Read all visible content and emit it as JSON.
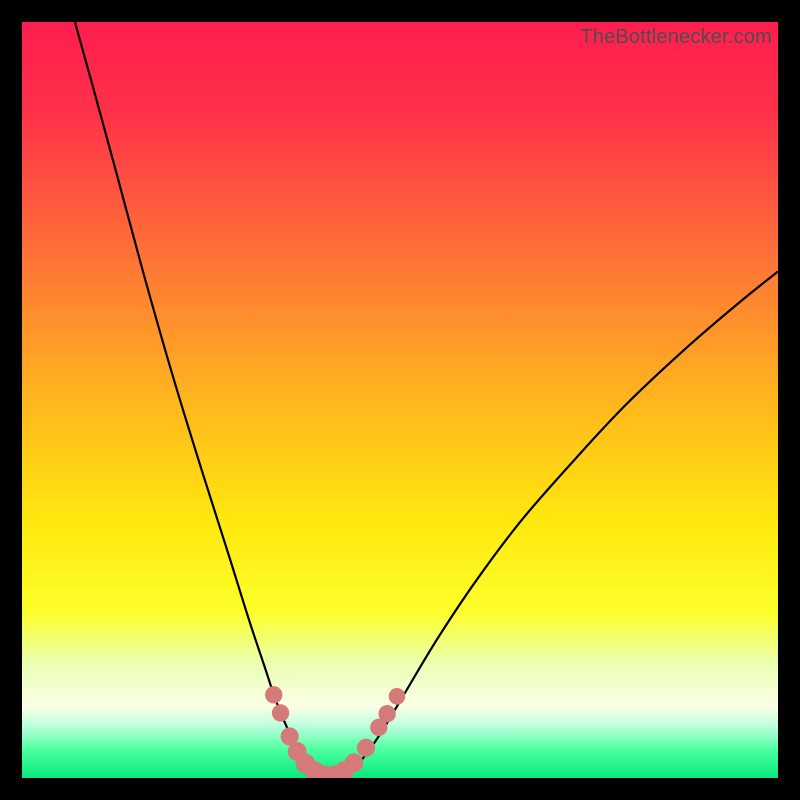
{
  "watermark": {
    "text": "TheBottlenecker.com"
  },
  "chart_data": {
    "type": "line",
    "title": "",
    "xlabel": "",
    "ylabel": "",
    "xlim": [
      0,
      100
    ],
    "ylim": [
      0,
      100
    ],
    "gradient_stops": [
      {
        "offset": 0,
        "color": "#ff1e4f"
      },
      {
        "offset": 0.12,
        "color": "#ff3149"
      },
      {
        "offset": 0.3,
        "color": "#ff6f38"
      },
      {
        "offset": 0.5,
        "color": "#ffb61e"
      },
      {
        "offset": 0.66,
        "color": "#ffe80e"
      },
      {
        "offset": 0.78,
        "color": "#fdff2a"
      },
      {
        "offset": 0.85,
        "color": "#eaffb4"
      },
      {
        "offset": 0.905,
        "color": "#fbffe6"
      },
      {
        "offset": 0.93,
        "color": "#bfffde"
      },
      {
        "offset": 0.965,
        "color": "#46ff9d"
      },
      {
        "offset": 1.0,
        "color": "#08e87f"
      }
    ],
    "series": [
      {
        "name": "left-curve",
        "points": [
          {
            "x": 7.0,
            "y": 100.0
          },
          {
            "x": 9.5,
            "y": 91.0
          },
          {
            "x": 12.5,
            "y": 80.0
          },
          {
            "x": 16.0,
            "y": 67.0
          },
          {
            "x": 20.0,
            "y": 53.0
          },
          {
            "x": 24.0,
            "y": 40.0
          },
          {
            "x": 27.5,
            "y": 29.0
          },
          {
            "x": 30.0,
            "y": 21.0
          },
          {
            "x": 32.0,
            "y": 15.0
          },
          {
            "x": 33.5,
            "y": 10.5
          },
          {
            "x": 35.0,
            "y": 6.8
          },
          {
            "x": 36.5,
            "y": 3.7
          },
          {
            "x": 38.0,
            "y": 1.6
          },
          {
            "x": 39.5,
            "y": 0.5
          },
          {
            "x": 41.0,
            "y": 0.0
          }
        ]
      },
      {
        "name": "right-curve",
        "points": [
          {
            "x": 41.0,
            "y": 0.0
          },
          {
            "x": 43.0,
            "y": 0.6
          },
          {
            "x": 45.0,
            "y": 2.5
          },
          {
            "x": 47.5,
            "y": 6.0
          },
          {
            "x": 50.5,
            "y": 11.0
          },
          {
            "x": 55.0,
            "y": 18.5
          },
          {
            "x": 60.0,
            "y": 26.0
          },
          {
            "x": 66.0,
            "y": 34.0
          },
          {
            "x": 73.0,
            "y": 42.0
          },
          {
            "x": 80.0,
            "y": 49.5
          },
          {
            "x": 88.0,
            "y": 57.0
          },
          {
            "x": 95.0,
            "y": 63.0
          },
          {
            "x": 100.0,
            "y": 67.0
          }
        ]
      }
    ],
    "markers": [
      {
        "x": 33.3,
        "y": 11.0,
        "r": 1.15
      },
      {
        "x": 34.2,
        "y": 8.6,
        "r": 1.15
      },
      {
        "x": 35.4,
        "y": 5.5,
        "r": 1.2
      },
      {
        "x": 36.4,
        "y": 3.5,
        "r": 1.25
      },
      {
        "x": 37.5,
        "y": 1.9,
        "r": 1.3
      },
      {
        "x": 38.7,
        "y": 0.9,
        "r": 1.3
      },
      {
        "x": 40.0,
        "y": 0.35,
        "r": 1.3
      },
      {
        "x": 41.3,
        "y": 0.35,
        "r": 1.3
      },
      {
        "x": 42.6,
        "y": 0.9,
        "r": 1.3
      },
      {
        "x": 43.9,
        "y": 2.0,
        "r": 1.25
      },
      {
        "x": 45.5,
        "y": 4.0,
        "r": 1.2
      },
      {
        "x": 47.2,
        "y": 6.7,
        "r": 1.15
      },
      {
        "x": 48.3,
        "y": 8.5,
        "r": 1.15
      },
      {
        "x": 49.6,
        "y": 10.8,
        "r": 1.1
      }
    ],
    "marker_color": "#d57a7a",
    "curve_color": "#000000",
    "curve_width": 2.2
  }
}
